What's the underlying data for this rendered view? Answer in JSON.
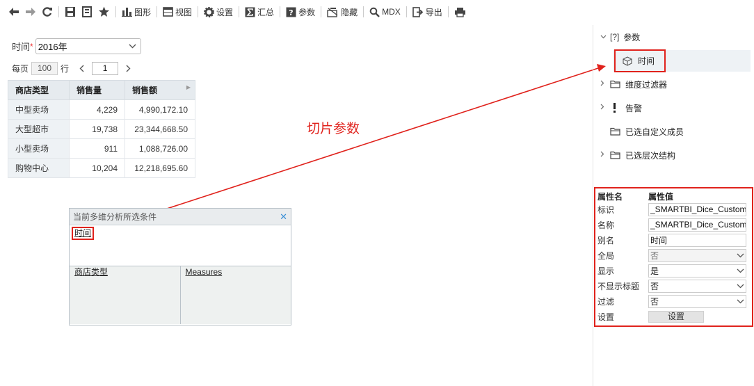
{
  "toolbar": {
    "chart_label": "图形",
    "view_label": "视图",
    "settings_label": "设置",
    "summary_label": "汇总",
    "params_label": "参数",
    "hide_label": "隐藏",
    "mdx_label": "MDX",
    "export_label": "导出"
  },
  "filter": {
    "label": "时间",
    "required_mark": "*",
    "value": "2016年"
  },
  "paging": {
    "per_page_label": "每页",
    "per_page_value": "100",
    "rows_label": "行",
    "page_value": "1"
  },
  "table": {
    "headers": [
      "商店类型",
      "销售量",
      "销售额"
    ],
    "rows": [
      [
        "中型卖场",
        "4,229",
        "4,990,172.10"
      ],
      [
        "大型超市",
        "19,738",
        "23,344,668.50"
      ],
      [
        "小型卖场",
        "911",
        "1,088,726.00"
      ],
      [
        "购物中心",
        "10,204",
        "12,218,695.60"
      ]
    ]
  },
  "annotation": {
    "label": "切片参数",
    "color": "#e0221c"
  },
  "dialog": {
    "title": "当前多维分析所选条件",
    "slice_token": "时间",
    "row_field": "商店类型",
    "column_field": "Measures"
  },
  "tree": {
    "params": "参数",
    "params_prefix": "[?]",
    "time": "时间",
    "dim_filter": "维度过滤器",
    "alert": "告警",
    "custom_members": "已选自定义成员",
    "hierarchy": "已选层次结构"
  },
  "props": {
    "name_header": "属性名",
    "value_header": "属性值",
    "rows": [
      {
        "name": "标识",
        "value": "_SMARTBI_Dice_Custom"
      },
      {
        "name": "名称",
        "value": "_SMARTBI_Dice_Custom"
      },
      {
        "name": "别名",
        "value": "时间"
      },
      {
        "name": "全局",
        "value": "否"
      },
      {
        "name": "显示",
        "value": "是"
      },
      {
        "name": "不显示标题",
        "value": "否"
      },
      {
        "name": "过滤",
        "value": "否"
      }
    ],
    "settings_row_label": "设置",
    "settings_button": "设置"
  }
}
